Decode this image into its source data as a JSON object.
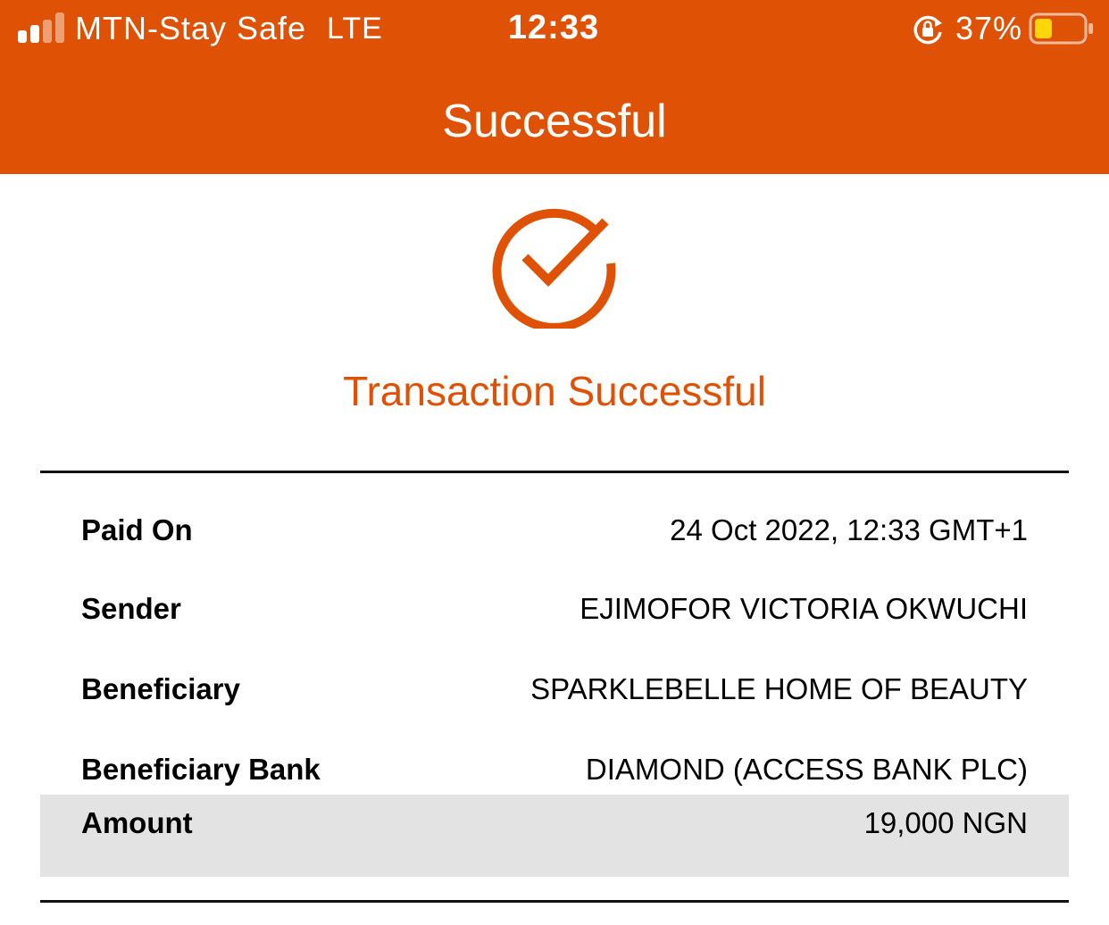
{
  "status_bar": {
    "carrier": "MTN-Stay Safe",
    "network": "LTE",
    "time": "12:33",
    "battery_percent": "37%",
    "icons": [
      "signal-icon",
      "rotation-lock-icon",
      "battery-icon"
    ],
    "signal_bars_filled": 2,
    "signal_bars_total": 4,
    "battery_level": 0.37
  },
  "header": {
    "title": "Successful",
    "background_color": "#df5206"
  },
  "status": {
    "icon": "check-circle-icon",
    "message": "Transaction Successful",
    "accent_color": "#df5206"
  },
  "details": [
    {
      "label": "Paid On",
      "value": "24 Oct 2022, 12:33 GMT+1"
    },
    {
      "label": "Sender",
      "value": "EJIMOFOR VICTORIA OKWUCHI"
    },
    {
      "label": "Beneficiary",
      "value": "SPARKLEBELLE HOME OF BEAUTY"
    },
    {
      "label": "Beneficiary Bank",
      "value": "DIAMOND (ACCESS BANK PLC)"
    },
    {
      "label": "Amount",
      "value": "19,000 NGN"
    }
  ]
}
